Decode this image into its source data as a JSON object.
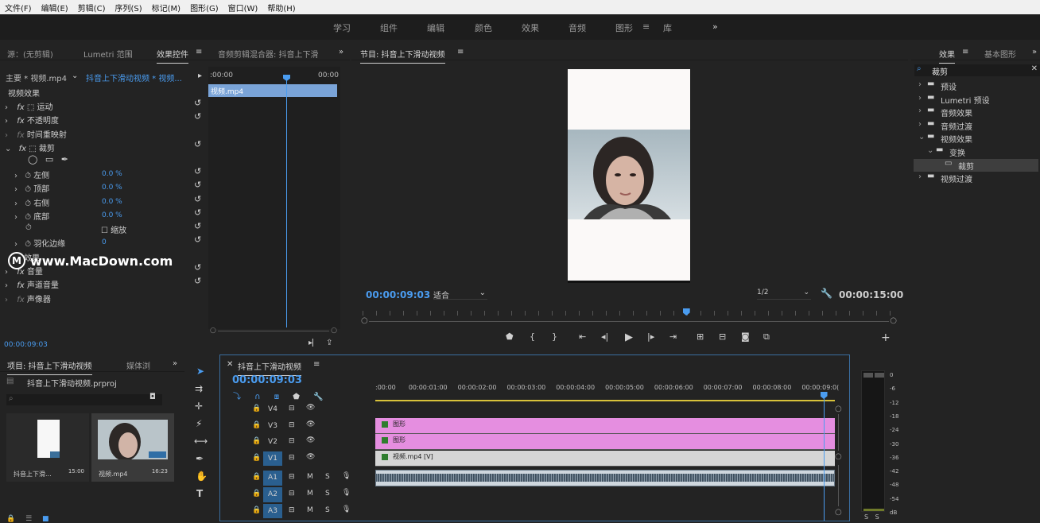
{
  "menubar": [
    "文件(F)",
    "编辑(E)",
    "剪辑(C)",
    "序列(S)",
    "标记(M)",
    "图形(G)",
    "窗口(W)",
    "帮助(H)"
  ],
  "workspaces": [
    "学习",
    "组件",
    "编辑",
    "颜色",
    "效果",
    "音频",
    "图形",
    "库"
  ],
  "workspace_active": "图形",
  "workspace_more": "»",
  "effect_controls": {
    "tabs": [
      "源：(无剪辑)",
      "Lumetri 范围",
      "效果控件",
      "音频剪辑混合器: 抖音上下滑"
    ],
    "master": "主要 * 视频.mp4",
    "sequence": "抖音上下滑动视频 * 视频...",
    "mini_time_start": ":00:00",
    "mini_time_end": "00:00",
    "clip_label": "视频.mp4",
    "section": "视频效果",
    "fx_motion": "运动",
    "fx_opacity": "不透明度",
    "fx_timeremap": "时间重映射",
    "fx_crop": "裁剪",
    "props": [
      {
        "name": "左侧",
        "value": "0.0 %"
      },
      {
        "name": "顶部",
        "value": "0.0 %"
      },
      {
        "name": "右侧",
        "value": "0.0 %"
      },
      {
        "name": "底部",
        "value": "0.0 %"
      }
    ],
    "zoom_label": "缩放",
    "feather": "羽化边缘",
    "feather_value": "0",
    "audio_section": "效果",
    "volume": "音量",
    "channel_volume": "声道音量",
    "panner": "声像器",
    "timecode": "00:00:09:03"
  },
  "watermark": "www.MacDown.com",
  "program": {
    "title": "节目: 抖音上下滑动视频",
    "timecode": "00:00:09:03",
    "fit": "适合",
    "quality": "1/2",
    "duration": "00:00:15:00",
    "playhead_fraction": 0.607
  },
  "effects_panel": {
    "tabs": [
      "效果",
      "基本图形"
    ],
    "search_value": "裁剪",
    "tree": [
      {
        "label": "预设",
        "depth": 0
      },
      {
        "label": "Lumetri 预设",
        "depth": 0
      },
      {
        "label": "音频效果",
        "depth": 0
      },
      {
        "label": "音频过渡",
        "depth": 0
      },
      {
        "label": "视频效果",
        "depth": 0
      },
      {
        "label": "变换",
        "depth": 1
      },
      {
        "label": "裁剪",
        "depth": 2,
        "selected": true
      },
      {
        "label": "视频过渡",
        "depth": 0
      }
    ]
  },
  "project": {
    "tab": "项目: 抖音上下滑动视频",
    "tab2": "媒体浏",
    "file": "抖音上下滑动视频.prproj",
    "items": [
      {
        "name": "抖音上下滑...",
        "duration": "15:00"
      },
      {
        "name": "视频.mp4",
        "duration": "16:23"
      }
    ]
  },
  "timeline": {
    "title": "抖音上下滑动视频",
    "timecode": "00:00:09:03",
    "ruler": [
      ":00:00",
      "00:00:01:00",
      "00:00:02:00",
      "00:00:03:00",
      "00:00:04:00",
      "00:00:05:00",
      "00:00:06:00",
      "00:00:07:00",
      "00:00:08:00",
      "00:00:09:0("
    ],
    "tracks": [
      "V4",
      "V3",
      "V2",
      "V1",
      "A1",
      "A2",
      "A3"
    ],
    "clips": [
      {
        "track": "V3",
        "label": "图形",
        "color": "#e58ee0"
      },
      {
        "track": "V2",
        "label": "图形",
        "color": "#e58ee0"
      },
      {
        "track": "V1",
        "label": "视频.mp4 [V]",
        "color": "#d5d5d5"
      }
    ],
    "playhead_fraction": 0.975
  },
  "meter_scale": [
    "0",
    "-6",
    "-12",
    "-18",
    "-24",
    "-30",
    "-36",
    "-42",
    "-48",
    "-54",
    "dB"
  ],
  "meter_foot": [
    "S",
    "S"
  ],
  "colors": {
    "accent": "#4a9cf0",
    "graphic_clip": "#e58ee0"
  }
}
